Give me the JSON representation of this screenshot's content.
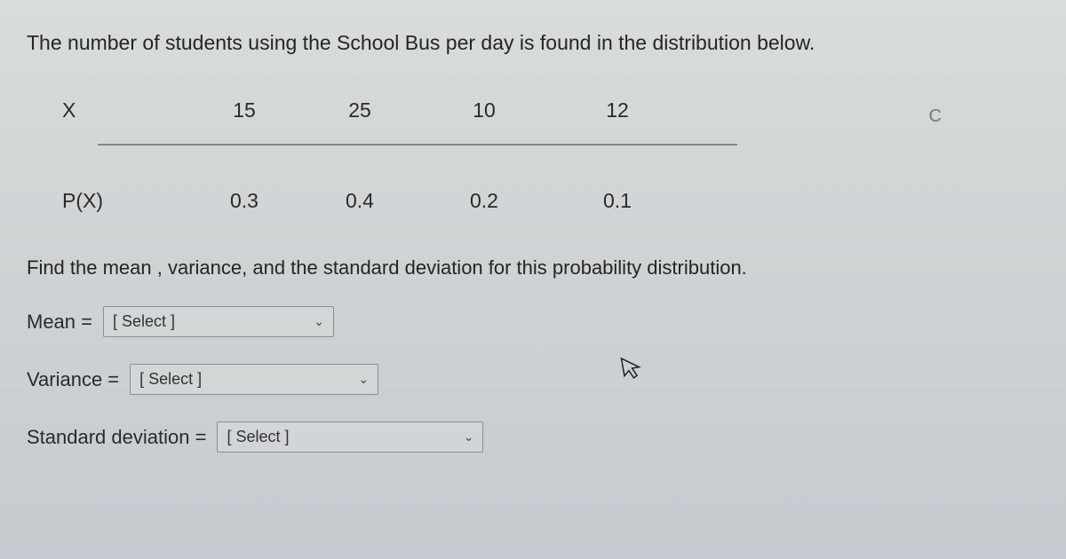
{
  "question": "The number of students using the School Bus per day is found in the distribution below.",
  "table": {
    "row1_label": "X",
    "row2_label": "P(X)",
    "x_values": [
      "15",
      "25",
      "10",
      "12"
    ],
    "p_values": [
      "0.3",
      "0.4",
      "0.2",
      "0.1"
    ]
  },
  "instruction": "Find the mean , variance, and the standard deviation for this probability distribution.",
  "answers": {
    "mean_label": "Mean =",
    "variance_label": "Variance =",
    "stddev_label": "Standard deviation =",
    "select_placeholder": "[ Select ]"
  },
  "refresh_symbol": "C"
}
